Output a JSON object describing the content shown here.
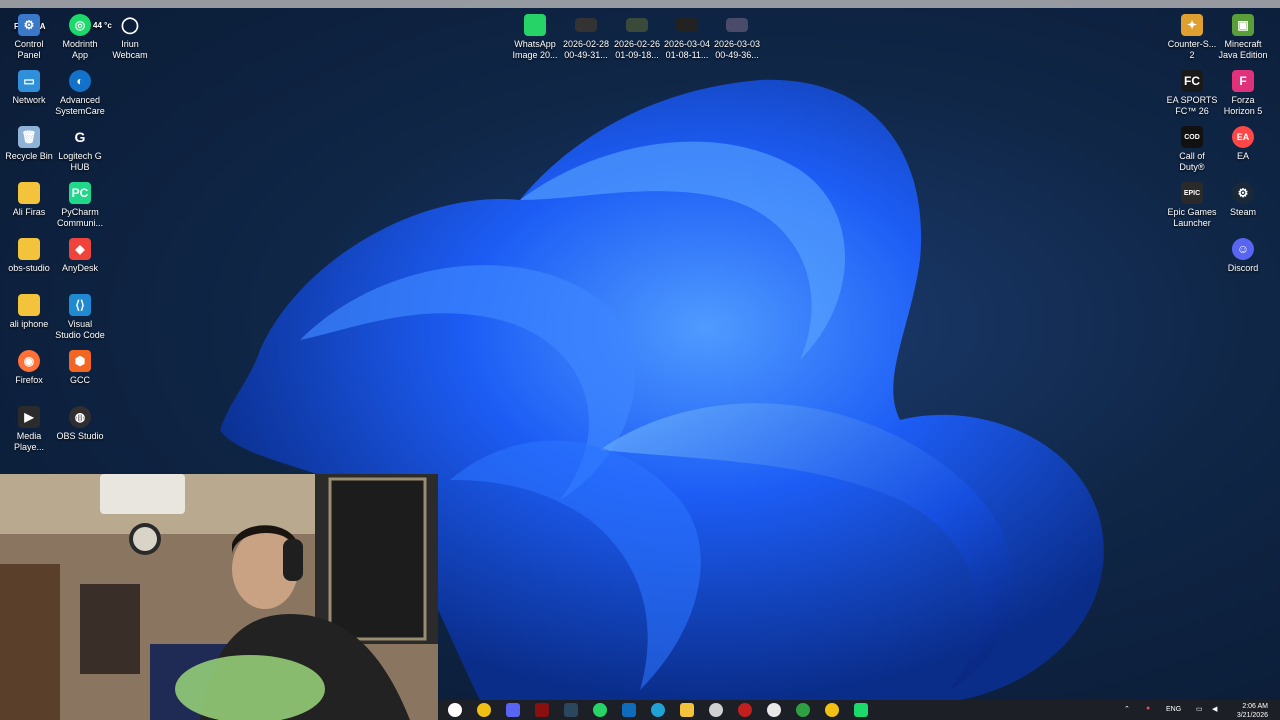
{
  "overlay": {
    "fps": "FPS N/A",
    "temp": "44 °c"
  },
  "icons_left": [
    {
      "label": "Control\nPanel"
    },
    {
      "label": "Modrinth\nApp"
    },
    {
      "label": "Iriun\nWebcam"
    },
    {
      "label": "Network"
    },
    {
      "label": "Advanced\nSystemCare"
    },
    {
      "label": "Recycle Bin"
    },
    {
      "label": "Logitech G\nHUB"
    },
    {
      "label": "Ali Firas"
    },
    {
      "label": "PyCharm\nCommuni..."
    },
    {
      "label": "obs-studio"
    },
    {
      "label": "AnyDesk"
    },
    {
      "label": "ali iphone"
    },
    {
      "label": "Visual\nStudio Code"
    },
    {
      "label": "Firefox"
    },
    {
      "label": "GCC"
    },
    {
      "label": "Media\nPlaye..."
    },
    {
      "label": "OBS Studio"
    }
  ],
  "icons_top": [
    {
      "label": "WhatsApp\nImage 20..."
    },
    {
      "label": "2026-02-28\n00-49-31..."
    },
    {
      "label": "2026-02-26\n01-09-18..."
    },
    {
      "label": "2026-03-04\n01-08-11..."
    },
    {
      "label": "2026-03-03\n00-49-36..."
    }
  ],
  "icons_right": [
    {
      "label": "Counter-S...\n2"
    },
    {
      "label": "Minecraft\nJava Edition"
    },
    {
      "label": "EA SPORTS\nFC™ 26"
    },
    {
      "label": "Forza\nHorizon 5"
    },
    {
      "label": "Call of\nDuty®"
    },
    {
      "label": "EA"
    },
    {
      "label": "Epic Games\nLauncher"
    },
    {
      "label": "Steam"
    },
    {
      "label": "Discord"
    }
  ],
  "taskbar": {
    "apps": [
      "xbox-icon",
      "chrome-icon",
      "discord-icon",
      "game-icon",
      "steam-icon",
      "whatsapp-icon",
      "calendar-icon",
      "edge-icon",
      "folder-icon",
      "chatgpt-icon",
      "media-icon",
      "chrome-profile-icon",
      "gpu-icon",
      "chrome-alt-icon",
      "app-icon"
    ],
    "language": "ENG",
    "time": "2:06 AM",
    "date": "3/21/2026"
  },
  "colors": {
    "accent": "#1e6cff",
    "taskbar": "#1c1f26"
  }
}
